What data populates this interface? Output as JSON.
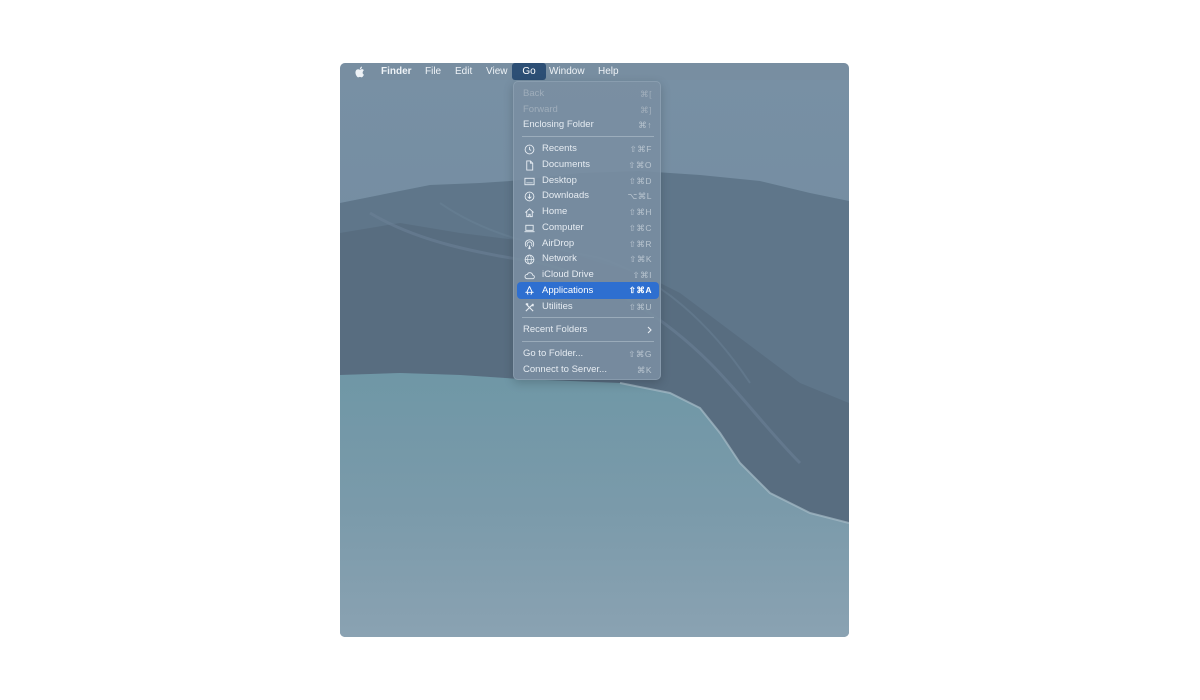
{
  "menubar": {
    "items": [
      "Finder",
      "File",
      "Edit",
      "View",
      "Go",
      "Window",
      "Help"
    ],
    "active": "Go"
  },
  "go_menu": {
    "items": [
      {
        "label": "Back",
        "shortcut": "⌘[",
        "enabled": false
      },
      {
        "label": "Forward",
        "shortcut": "⌘]",
        "enabled": false
      },
      {
        "label": "Enclosing Folder",
        "shortcut": "⌘↑",
        "enabled": true
      },
      {
        "label": "Recents",
        "shortcut": "⇧⌘F",
        "icon": "clock-icon"
      },
      {
        "label": "Documents",
        "shortcut": "⇧⌘O",
        "icon": "document-icon"
      },
      {
        "label": "Desktop",
        "shortcut": "⇧⌘D",
        "icon": "desktop-icon"
      },
      {
        "label": "Downloads",
        "shortcut": "⌥⌘L",
        "icon": "download-icon"
      },
      {
        "label": "Home",
        "shortcut": "⇧⌘H",
        "icon": "home-icon"
      },
      {
        "label": "Computer",
        "shortcut": "⇧⌘C",
        "icon": "laptop-icon"
      },
      {
        "label": "AirDrop",
        "shortcut": "⇧⌘R",
        "icon": "airdrop-icon"
      },
      {
        "label": "Network",
        "shortcut": "⇧⌘K",
        "icon": "globe-icon"
      },
      {
        "label": "iCloud Drive",
        "shortcut": "⇧⌘I",
        "icon": "cloud-icon"
      },
      {
        "label": "Applications",
        "shortcut": "⇧⌘A",
        "icon": "applications-icon",
        "highlighted": true
      },
      {
        "label": "Utilities",
        "shortcut": "⇧⌘U",
        "icon": "tools-icon"
      },
      {
        "label": "Recent Folders",
        "submenu": true
      },
      {
        "label": "Go to Folder...",
        "shortcut": "⇧⌘G"
      },
      {
        "label": "Connect to Server...",
        "shortcut": "⌘K"
      }
    ]
  },
  "colors": {
    "highlight": "#2e6fd0",
    "active_menu": "#2d4f75",
    "wallpaper_tint": "#6f8aa0"
  }
}
